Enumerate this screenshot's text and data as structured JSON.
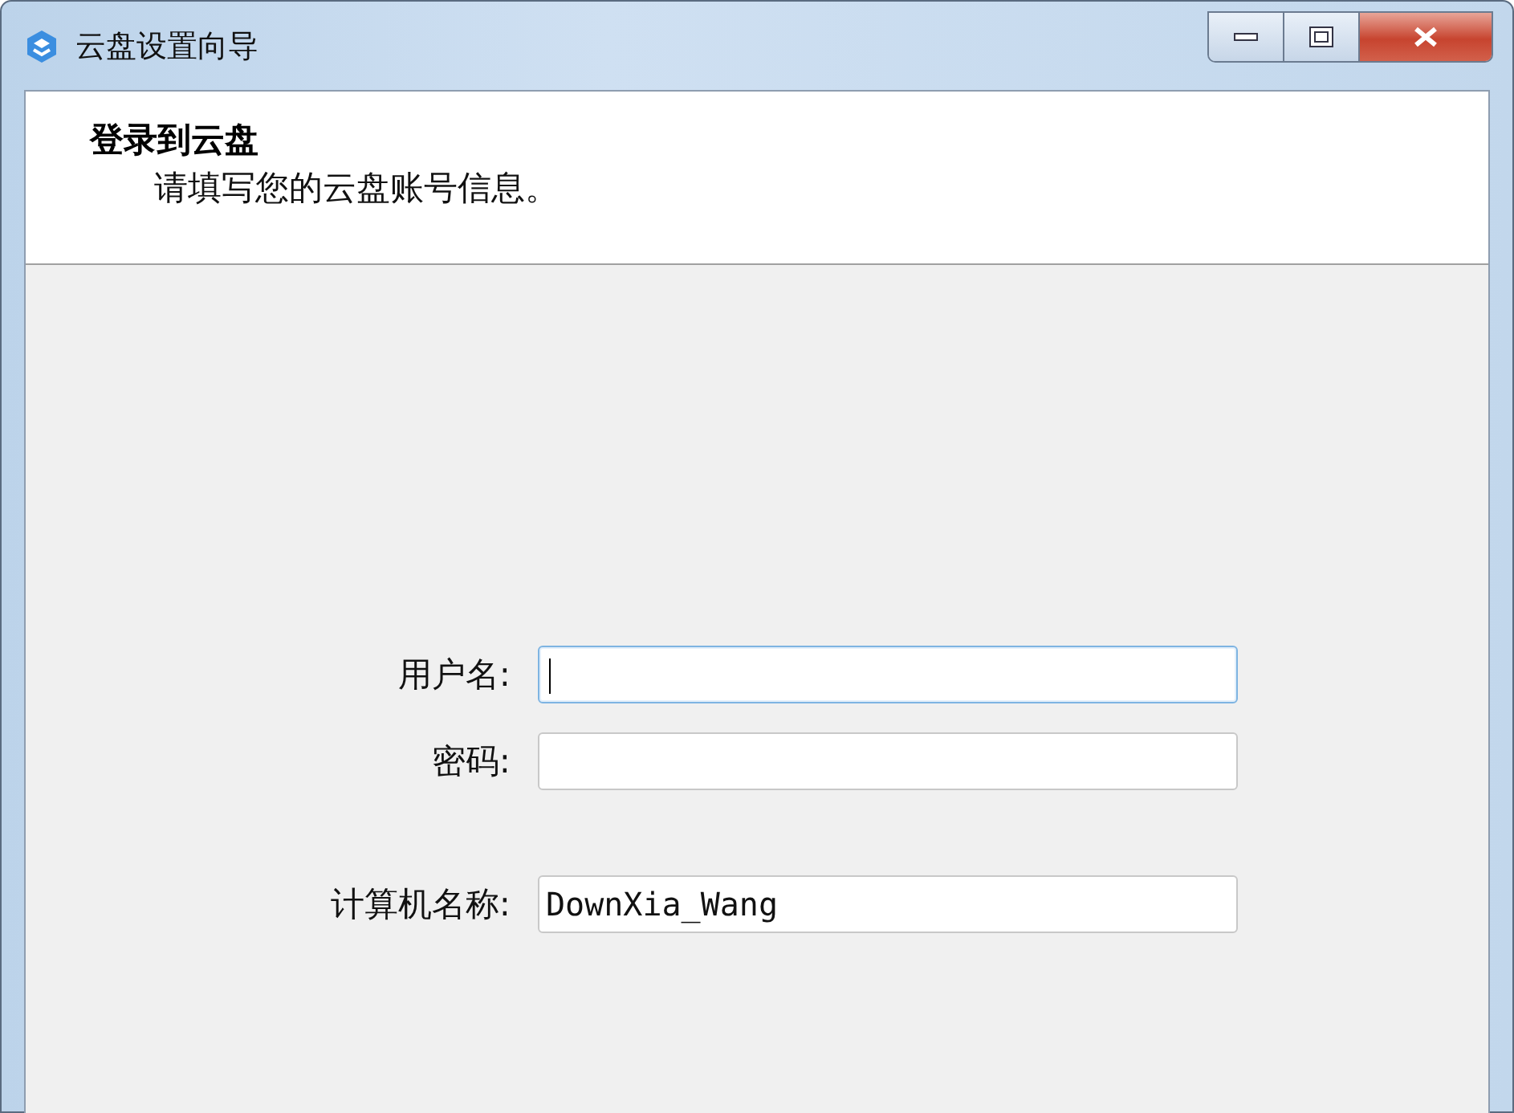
{
  "window": {
    "title": "云盘设置向导"
  },
  "header": {
    "title": "登录到云盘",
    "subtitle": "请填写您的云盘账号信息。"
  },
  "form_groups": [
    [
      {
        "label": "用户名:",
        "focused": true
      },
      {
        "label": "密码:",
        "focused": false
      }
    ],
    [
      {
        "label": "计算机名称:",
        "value": "DownXia_Wang",
        "focused": false
      }
    ]
  ]
}
